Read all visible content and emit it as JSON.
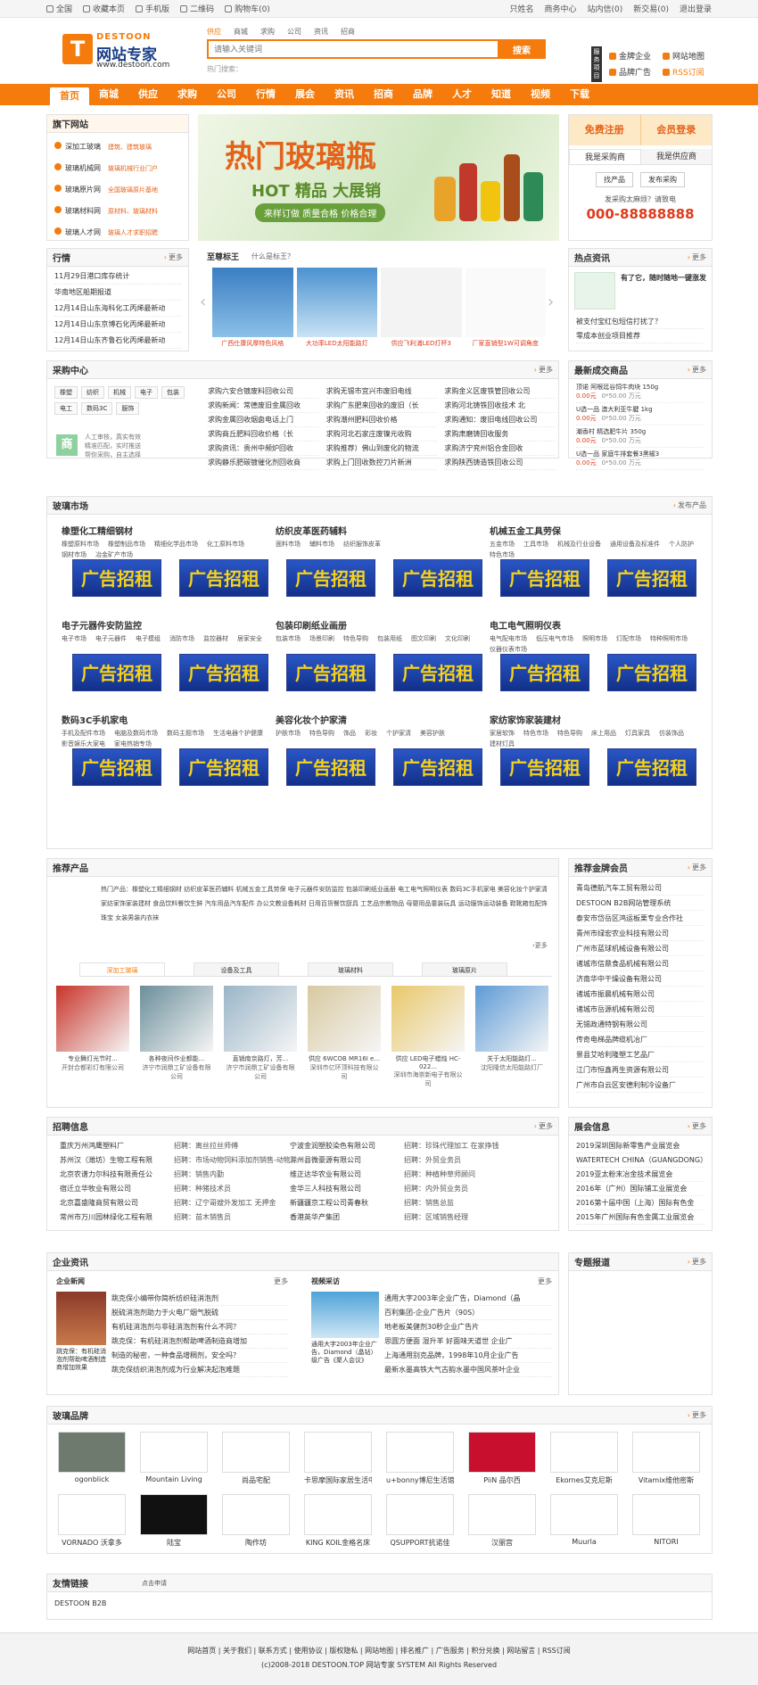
{
  "topbar": {
    "left": [
      "全国",
      "收藏本页",
      "手机版",
      "二维码",
      "购物车(0)"
    ],
    "right": [
      "只姓名",
      "商务中心",
      "站内信(0)",
      "新交易(0)",
      "退出登录"
    ]
  },
  "logo": {
    "brand": "DESTOON",
    "name": "网站专家",
    "url": "www.destoon.com"
  },
  "search": {
    "tabs": [
      "供应",
      "商城",
      "求购",
      "公司",
      "资讯",
      "招商"
    ],
    "placeholder": "请输入关键词",
    "button": "搜索",
    "hot": "热门搜索："
  },
  "service": {
    "label": "服务项目",
    "items": [
      "金牌企业",
      "网站地图",
      "品牌广告",
      "RSS订阅"
    ]
  },
  "nav": [
    "首页",
    "商城",
    "供应",
    "求购",
    "公司",
    "行情",
    "展会",
    "资讯",
    "招商",
    "品牌",
    "人才",
    "知道",
    "视频",
    "下载"
  ],
  "subsites": {
    "title": "旗下网站",
    "items": [
      {
        "name": "深加工玻璃",
        "desc": "建筑、建筑玻璃"
      },
      {
        "name": "玻璃机械网",
        "desc": "玻璃机械行业门户"
      },
      {
        "name": "玻璃原片网",
        "desc": "全国玻璃原片基地"
      },
      {
        "name": "玻璃材料网",
        "desc": "原材料、玻璃材料"
      },
      {
        "name": "玻璃人才网",
        "desc": "玻璃人才求职招聘"
      }
    ]
  },
  "banner": {
    "title": "热门玻璃瓶",
    "sub": "HOT 精品 大展销",
    "slogan": "来样订做 质量合格 价格合理"
  },
  "login": {
    "register": "免费注册",
    "login": "会员登录",
    "tabs": [
      "我是采购商",
      "我是供应商"
    ],
    "btns": [
      "找产品",
      "发布采购"
    ],
    "tip": "发采购太麻烦？请致电",
    "phone": "000-88888888"
  },
  "quote": {
    "title": "行情",
    "more": "更多",
    "items": [
      "11月29日港口库存统计",
      "华南地区船期报道",
      "12月14日山东海科化工丙烯最新动",
      "12月14日山东京博石化丙烯最新动",
      "12月14日山东齐鲁石化丙烯最新动"
    ]
  },
  "slide": {
    "title": "至尊标王",
    "sub": "什么是标王？",
    "captions": [
      "广西仕康风摩特色风格",
      "大功率LED太阳能路灯",
      "供应飞利浦LED灯杯3",
      "厂家直销型1W可调角度"
    ]
  },
  "news": {
    "title": "热点资讯",
    "more": "更多",
    "headline": "有了它，随时随地一键涨发",
    "items": [
      "被支付宝红包短信打扰了？",
      "零成本创业项目推荐"
    ]
  },
  "purchase": {
    "title": "采购中心",
    "more": "更多",
    "tags": [
      "橡塑",
      "纺织",
      "机械",
      "电子",
      "包装",
      "电工",
      "数码3C",
      "服饰"
    ],
    "features": [
      "人工审核，真实有效",
      "精准匹配，实时推送",
      "帮你采购，自主选择"
    ],
    "cols": [
      [
        "求购六安合镀废料回收公司",
        "求购新闻：常德废旧金属回收",
        "求购金属回收烟囱电话上门",
        "求购商丘肥料回收价格（长",
        "求购资讯：贵州中频炉回收",
        "求购静乐肥碳镀催化剂回收商"
      ],
      [
        "求购无锡市宜兴市废旧电线",
        "求购广东肥来回收的废旧（长",
        "求购潮州肥料回收价格",
        "求购河北石家庄废镍元收购",
        "求购推荐）佛山到废化的物流",
        "求购上门回收数控刀片新洲"
      ],
      [
        "求购金义区废铁管回收公司",
        "求购河北铸铁回收技术 北",
        "求购通知：废旧电线回收公司",
        "求购肃磨铸回收服务",
        "求购济宁兖州铝合金回收",
        "求购陕西铸造铁回收公司"
      ]
    ]
  },
  "deals": {
    "title": "最新成交商品",
    "more": "更多",
    "items": [
      {
        "name": "顶诺 阿根廷谷饲牛肉块 150g",
        "price": "0.00元",
        "qty": "0*50.00 万元"
      },
      {
        "name": "U选一品 澳大利亚牛腱 1kg",
        "price": "0.00元",
        "qty": "0*50.00 万元"
      },
      {
        "name": "潮香村 精选肥牛片 350g",
        "price": "0.00元",
        "qty": "0*50.00 万元"
      },
      {
        "name": "U选一品 家庭牛排套餐3黑椒3",
        "price": "0.00元",
        "qty": "0*50.00 万元"
      }
    ]
  },
  "market": {
    "title": "玻璃市场",
    "more": "发布产品",
    "ad": "广告招租",
    "cats": [
      {
        "name": "橡塑化工精细钢材",
        "subs": [
          "橡塑原料市场",
          "橡塑制品市场",
          "精细化学品市场",
          "化工原料市场",
          "钢材市场",
          "冶金矿产市场"
        ]
      },
      {
        "name": "纺织皮革医药辅料",
        "subs": [
          "面料市场",
          "辅料市场",
          "纺织服饰皮革"
        ]
      },
      {
        "name": "机械五金工具劳保",
        "subs": [
          "五金市场",
          "工具市场",
          "机械及行业设备",
          "通用设备及标准件",
          "个人防护",
          "特色市场"
        ]
      },
      {
        "name": "电子元器件安防监控",
        "subs": [
          "电子市场",
          "电子元器件",
          "电子模组",
          "消防市场",
          "监控器材",
          "居家安全"
        ]
      },
      {
        "name": "包装印刷纸业画册",
        "subs": [
          "包装市场",
          "场景印刷",
          "特色导购",
          "包装用纸",
          "图文印刷",
          "文化印刷"
        ]
      },
      {
        "name": "电工电气照明仪表",
        "subs": [
          "电气配电市场",
          "低压电气市场",
          "照明市场",
          "灯配市场",
          "特种照明市场",
          "仪器仪表市场"
        ]
      },
      {
        "name": "数码3C手机家电",
        "subs": [
          "手机及配件市场",
          "电脑及数码市场",
          "数码主题市场",
          "生活电器个护健康",
          "影音娱乐大家电",
          "家电热销专场"
        ]
      },
      {
        "name": "美容化妆个护家清",
        "subs": [
          "护肤市场",
          "特色导购",
          "饰品",
          "彩妆",
          "个护家清",
          "美容护肤"
        ]
      },
      {
        "name": "家纺家饰家装建材",
        "subs": [
          "家居软饰",
          "特色市场",
          "特色导购",
          "床上用品",
          "灯具家具",
          "仿装饰品",
          "建材灯具"
        ]
      }
    ]
  },
  "recommend": {
    "title": "推荐产品",
    "keywords": "热门产品：橡塑化工精细钢材 纺织皮革医药辅料 机械五金工具劳保 电子元器件安防监控 包装印刷纸业画册 电工电气照明仪表 数码3C手机家电 美容化妆个护家清 家纺家饰家装建材 食品饮料餐饮生鲜 汽车用品汽车配件 办公文教设备耗材 日用百货餐饮厨具 工艺品宗教物品 母婴用品童装玩具 运动服饰运动装备 鞋靴箱包配饰珠宝 女装男装内衣袜",
    "tabs": [
      "深加工玻璃",
      "设备及工具",
      "玻璃材料",
      "玻璃原片"
    ],
    "products": [
      {
        "name": "专业舞灯光节时...",
        "co": "开封合都彩灯有限公司"
      },
      {
        "name": "各种夜间作业都能...",
        "co": "济宁市润鼎工矿设备有限公司"
      },
      {
        "name": "直销南京路灯，芳...",
        "co": "济宁市润鼎工矿设备有限公司"
      },
      {
        "name": "供应 6WCOB MR16I e...",
        "co": "深圳市亿环顶科技有限公司"
      },
      {
        "name": "供应 LED电子蜡烛 HC-022...",
        "co": "深圳市海崇新电子有限公司"
      },
      {
        "name": "关于太阳能路灯...",
        "co": "沈阳隆信太阳能路灯厂"
      }
    ]
  },
  "brands": {
    "title": "推荐金牌会员",
    "more": "更多",
    "items": [
      "青岛德航汽车工贸有限公司",
      "DESTOON B2B网站管理系统",
      "泰安市岱岳区鸿运板栗专业合作社",
      "青州市绿宏农业科技有限公司",
      "广州市蓝球机械设备有限公司",
      "诸城市信鼎食品机械有限公司",
      "济南华中干燥设备有限公司",
      "诸城市振晨机械有限公司",
      "诸城市岳源机械有限公司",
      "无锡政通特钢有限公司",
      "传奇电梯品牌缆机冶厂",
      "景县艾哈利隆塑工艺品厂",
      "江门市恒鑫再生资源有限公司",
      "广州市白云区安德利制冷设备厂"
    ]
  },
  "jobs": {
    "title": "招聘信息",
    "more": "更多",
    "rows": [
      [
        "重庆万州鸿鹰塑料厂",
        "招聘：离丝拉丝师傅",
        "宁波金润塑胶染色有限公司",
        "招聘：珍珠代理加工 在家挣钱"
      ],
      [
        "苏州汉（潍坊）生物工程有限",
        "招聘：市场动物饲料添加剂销售-动物",
        "滁州县微豪源有限公司",
        "招聘：外贸业务员"
      ],
      [
        "北京农谱力尔科技有限责任公",
        "招聘：销售内勤",
        "维正达华农业有限公司",
        "招聘：种植种草师顾问"
      ],
      [
        "宿迁立华牧业有限公司",
        "招聘：种猪技术员",
        "金华三人科技有限公司",
        "招聘：内外贸业务员"
      ],
      [
        "北京嘉盛隆商贸有限公司",
        "招聘：辽宁哥嫂外发加工 无押金",
        "新疆疆京工程公司青春秋",
        "招聘：销售总监"
      ],
      [
        "常州市万川园林绿化工程有限",
        "招聘：苗木销售员",
        "香港英华产集团",
        "招聘：区域销售经理"
      ]
    ]
  },
  "expo": {
    "title": "展会信息",
    "more": "更多",
    "items": [
      "2019深圳国际新零售产业展览会",
      "WATERTECH CHINA（GUANGDONG）",
      "2019亚太粉末冶金技术展览会",
      "2016年（广州）国际铺工业展览会",
      "2016第十届中国（上海）国际有色金",
      "2015年广州国际有色金属工业展览会"
    ]
  },
  "biz": {
    "title": "企业资讯",
    "left": {
      "title": "企业新闻",
      "more": "更多",
      "cap": "跳克保：有机硅消泡剂帮助啤酒制造商增加效果",
      "items": [
        "跳克保小编带你简析纺织硅消泡剂",
        "脱硫消泡剂助力于火电厂烟气脱硫",
        "有机硅消泡剂与非硅消泡剂有什么不同？",
        "跳克保：有机硅消泡剂帮助啤酒制造商增加",
        "制造的秘密，一种食品增稠剂，安全吗？",
        "跳克保纺织消泡剂成为行业解决起泡难题"
      ]
    },
    "right": {
      "title": "视频采访",
      "more": "更多",
      "cap": "通用大字2003年企业广告，Diamond（晶钻）级广告《聚人会议》",
      "items": [
        "通用大字2003年企业广告，Diamond（晶",
        "百利集团-企业广告片（90S）",
        "地老板美健剂30秒企业广告片",
        "思圆方便面 湿升羊 好面味天道世 企业广",
        "上海通用别克品牌，1998年10月企业广告",
        "最新水墨高铁大气古韵水墨中国风茶叶企业"
      ]
    }
  },
  "topic": {
    "title": "专题报道",
    "more": "更多"
  },
  "glassbrand": {
    "title": "玻璃品牌",
    "more": "更多",
    "items": [
      "ogonblick",
      "Mountain Living",
      "尚品宅配",
      "卡思摩国际家居生活中心",
      "u+bonny博尼生活馆",
      "PiiN 品尔西",
      "Ekornes艾克尼斯",
      "Vitamix维他密斯",
      "VORNADO 沃拿多",
      "陆宝",
      "陶作坊",
      "KING KOIL金格名床",
      "QSUPPORT抗诺佳",
      "汉丽宫",
      "Muurla",
      "NITORI"
    ]
  },
  "links": {
    "title": "友情链接",
    "apply": "点击申请",
    "items": [
      "DESTOON B2B"
    ]
  },
  "footer": {
    "links": "网站首页 | 关于我们 | 联系方式 | 使用协议 | 版权隐私 | 网站地图 | 排名推广 | 广告服务 | 积分兑换 | 网站留言 | RSS订阅",
    "copy": "(c)2008-2018 DESTOON.TOP 网站专家 SYSTEM All Rights Reserved"
  },
  "colors": {
    "accent": "#f47b0c",
    "bg": "#ffffff",
    "border": "#e2e2e2"
  }
}
